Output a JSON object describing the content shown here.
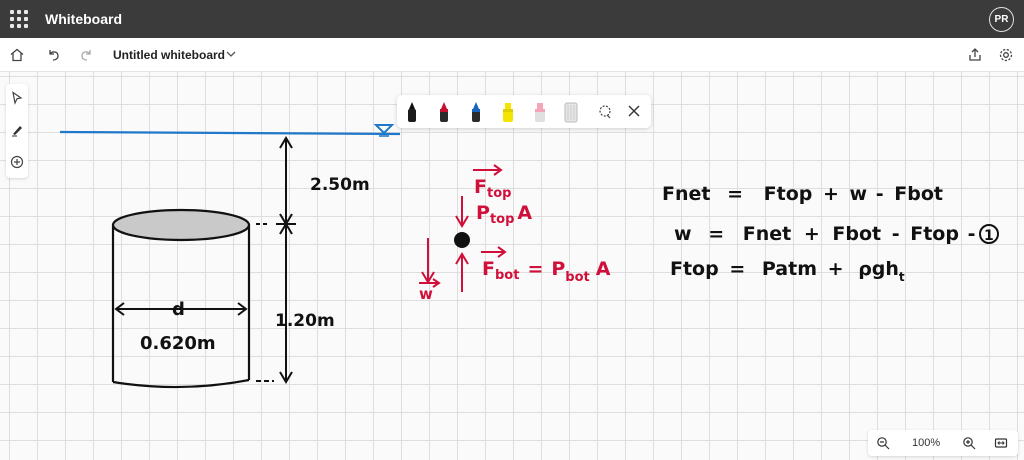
{
  "app": {
    "title": "Whiteboard",
    "avatar_initials": "PR"
  },
  "toolbar": {
    "doc_title": "Untitled whiteboard"
  },
  "zoom": {
    "level": "100%"
  },
  "colors": {
    "topbar": "#3b3b3b",
    "ink_black": "#111111",
    "ink_red": "#d0103a",
    "water_blue": "#1f78c8"
  },
  "icons": {
    "left_tools": [
      "pointer-icon",
      "pen-icon",
      "add-icon"
    ],
    "pens": [
      "black-pen-icon",
      "red-pen-icon",
      "blue-pen-icon",
      "yellow-highlighter-icon",
      "pink-highlighter-icon",
      "eraser-icon",
      "lasso-icon",
      "close-icon"
    ]
  },
  "drawing": {
    "depth_label": "2.50m",
    "height_label": "1.20m",
    "d_label": "d",
    "diameter_label": "0.620m",
    "fbd": {
      "ftop_vec": "F",
      "ftop_sub": "top",
      "ptop_a": "P",
      "ptop_a_sub": "top",
      "ptop_a_suffix": "A",
      "fbot_vec": "F",
      "fbot_sub": "bot",
      "eq": "=",
      "pbot": "P",
      "pbot_sub": "bot",
      "pbot_suffix": "A",
      "w": "w"
    },
    "eq1": {
      "lhs": "Fnet",
      "eq": "=",
      "t1": "Ftop",
      "op1": "+",
      "t2": "w",
      "op2": "-",
      "t3": "Fbot"
    },
    "eq2": {
      "lhs": "w",
      "eq": "=",
      "t1": "Fnet",
      "op1": "+",
      "t2": "Fbot",
      "op2": "-",
      "t3": "Ftop",
      "op3": "-",
      "marker": "1"
    },
    "eq3": {
      "lhs": "Ftop",
      "eq": "=",
      "t1": "Patm",
      "op1": "+",
      "t2": "ρgh",
      "t2_sub": "t"
    }
  }
}
